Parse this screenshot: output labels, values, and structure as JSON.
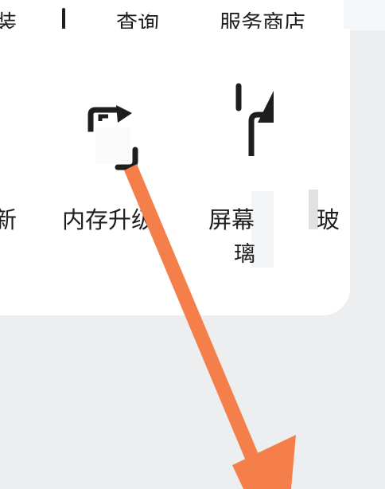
{
  "top_row": {
    "items": [
      {
        "label": "装"
      },
      {
        "label": "查询"
      },
      {
        "label": "服务商店"
      }
    ]
  },
  "service_row": {
    "items": [
      {
        "label": "新"
      },
      {
        "label": "内存升级",
        "icon": "memory-upgrade-icon"
      },
      {
        "label_line1": "屏幕",
        "label_line2": "璃",
        "label_tail": "玻",
        "icon": "screen-glass-icon"
      }
    ]
  },
  "annotation": {
    "arrow_color": "#f47f4a",
    "direction": "down-right"
  },
  "colors": {
    "background": "#eceef0",
    "card": "#ffffff",
    "text": "#1e1e1e",
    "arrow": "#f47f4a"
  }
}
